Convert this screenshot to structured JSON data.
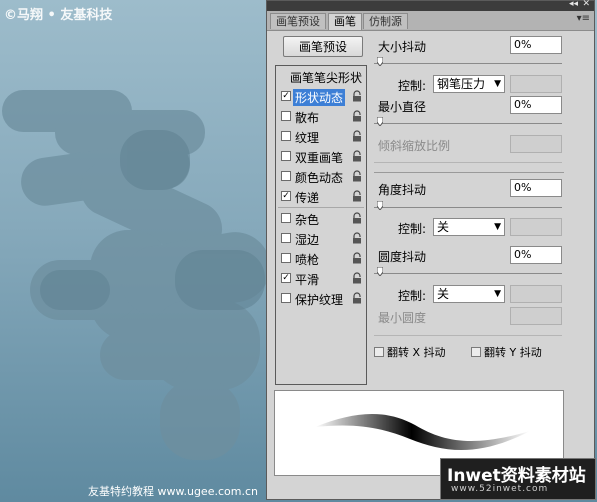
{
  "canvas": {
    "watermark": "©马翔 • 友基科技",
    "credit": "友基特约教程 www.ugee.com.cn",
    "logo_line1": "Inwet资料素材站",
    "logo_line2": "www.52inwet.com"
  },
  "panel": {
    "tabs": [
      "画笔预设",
      "画笔",
      "仿制源"
    ],
    "active_tab": "画笔",
    "menu_glyph": "▾≡",
    "presets_button": "画笔预设",
    "list_header": "画笔笔尖形状",
    "items": [
      {
        "label": "形状动态",
        "checked": true,
        "selected": true
      },
      {
        "label": "散布",
        "checked": false
      },
      {
        "label": "纹理",
        "checked": false
      },
      {
        "label": "双重画笔",
        "checked": false
      },
      {
        "label": "颜色动态",
        "checked": false
      },
      {
        "label": "传递",
        "checked": true
      },
      {
        "label": "杂色",
        "checked": false
      },
      {
        "label": "湿边",
        "checked": false
      },
      {
        "label": "喷枪",
        "checked": false
      },
      {
        "label": "平滑",
        "checked": true
      },
      {
        "label": "保护纹理",
        "checked": false
      }
    ],
    "check_glyph": "✓",
    "size_jitter": {
      "label": "大小抖动",
      "value": "0%"
    },
    "control1": {
      "label": "控制:",
      "value": "钢笔压力"
    },
    "min_diameter": {
      "label": "最小直径",
      "value": "0%"
    },
    "tilt_scale": {
      "label": "倾斜缩放比例"
    },
    "angle_jitter": {
      "label": "角度抖动",
      "value": "0%"
    },
    "control2": {
      "label": "控制:",
      "value": "关"
    },
    "roundness_jitter": {
      "label": "圆度抖动",
      "value": "0%"
    },
    "control3": {
      "label": "控制:",
      "value": "关"
    },
    "min_roundness": {
      "label": "最小圆度"
    },
    "flip_x": "翻转 X 抖动",
    "flip_y": "翻转 Y 抖动",
    "colors": {
      "selection": "#3d7fd6",
      "panel": "#d4d4d4"
    }
  }
}
